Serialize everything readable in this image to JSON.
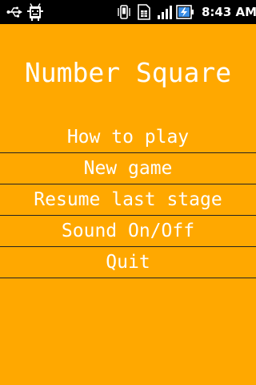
{
  "status_bar": {
    "time": "8:43 AM",
    "icons": [
      "usb-icon",
      "debug-icon",
      "vibrate-icon",
      "sim-card-icon",
      "signal-icon",
      "battery-charging-icon"
    ],
    "background_color": "#000000",
    "icon_color": "#ffffff",
    "battery_color": "#3a8ee6"
  },
  "app": {
    "background_color": "#ffa800",
    "text_color": "#ffffff",
    "divider_color": "#222222",
    "title": "Number Square",
    "menu": {
      "how_to_play": "How to play",
      "new_game": "New game",
      "resume": "Resume last stage",
      "sound": "Sound On/Off",
      "quit": "Quit"
    }
  }
}
